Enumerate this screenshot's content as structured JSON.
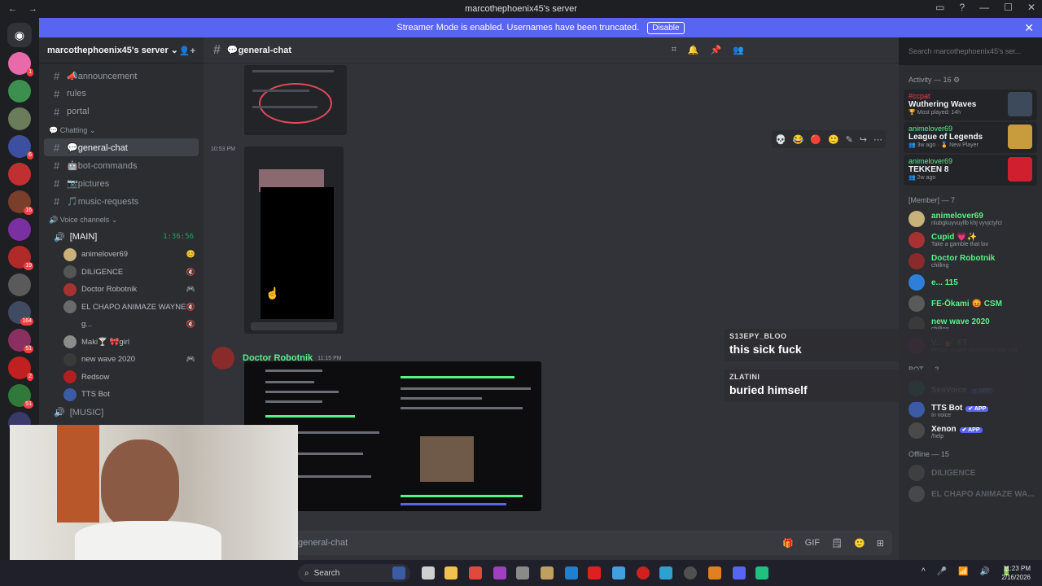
{
  "window": {
    "title": "marcothephoenix45's server",
    "nav_back": "←",
    "nav_forward": "→",
    "controls": [
      "▭",
      "?",
      "—",
      "☐",
      "✕"
    ]
  },
  "banner": {
    "text": "Streamer Mode is enabled. Usernames have been truncated.",
    "button": "Disable",
    "close": "✕"
  },
  "guild_badges": [
    "1",
    "6",
    "16",
    "19",
    "164",
    "51",
    "2",
    "51",
    "62"
  ],
  "sidebar": {
    "server_name": "marcothephoenix45's server ⌄",
    "channels_top": [
      {
        "label": "📣announcement"
      },
      {
        "label": "rules"
      },
      {
        "label": "portal"
      }
    ],
    "category_chatting": "💬 Chatting ⌄",
    "channels_chat": [
      {
        "label": "💬general-chat"
      },
      {
        "label": "🤖bot-commands"
      },
      {
        "label": "📷pictures"
      },
      {
        "label": "🎵music-requests"
      }
    ],
    "category_voice": "🔊 Voice channels ⌄",
    "voice_main": "[MAIN]",
    "voice_timer": "1:36:56",
    "voice_users": [
      {
        "name": "animelover69",
        "color": "#c9b27a",
        "icon": "😊"
      },
      {
        "name": "DILIGENCE",
        "color": "#555555",
        "icon": "🔇"
      },
      {
        "name": "Doctor Robotnik",
        "color": "#a83232",
        "icon": "🎮"
      },
      {
        "name": "EL CHAPO ANIMAZE WAYNE",
        "color": "#6a6a6a",
        "icon": "🔇"
      },
      {
        "name": "g...",
        "color": "#2b2d31",
        "icon": "🔇"
      },
      {
        "name": "Maki🍸 🎀girl",
        "color": "#8c8c8c",
        "icon": ""
      },
      {
        "name": "new wave 2020",
        "color": "#3a3a3a",
        "icon": "🎮"
      },
      {
        "name": "Redsow",
        "color": "#b02020",
        "icon": ""
      },
      {
        "name": "TTS Bot",
        "color": "#3b5ba5",
        "icon": ""
      }
    ],
    "voice_music": "[MUSIC]"
  },
  "chat": {
    "channel": "💬general-chat",
    "timestamp_1": "10:53 PM",
    "message_author": "Doctor Robotnik",
    "message_time": "11:15 PM",
    "composer_placeholder": "general-chat",
    "header_icons": [
      "⌗",
      "🔔",
      "📌",
      "👥"
    ],
    "toolbar_icons": [
      "💀",
      "😂",
      "🔴",
      "🙂",
      "✎",
      "↪",
      "⋯"
    ],
    "composer_tools": [
      "🎁",
      "GIF",
      "🗒",
      "🙂",
      "⊞"
    ]
  },
  "search": {
    "placeholder": "Search marcothephoenix45's ser..."
  },
  "members": {
    "activity_header": "Activity — 16 ⚙",
    "activities": [
      {
        "user": "#ccpat",
        "game": "Wuthering Waves",
        "detail": "🏆 Most played: 14h",
        "user_color": "#f23f43",
        "art": "#3c4a5c"
      },
      {
        "user": "animelover69",
        "game": "League of Legends",
        "detail": "👥 3w ago · 🏅 New Player",
        "user_color": "#57f287",
        "art": "#c89b3c"
      },
      {
        "user": "animelover69",
        "game": "TEKKEN 8",
        "detail": "👥 2w ago",
        "user_color": "#57f287",
        "art": "#d02030"
      }
    ],
    "member_header": "[Member] — 7",
    "member_list": [
      {
        "name": "animelover69",
        "status": "nlubgkuyvuyllb khj vyvjctyfcl",
        "color": "#57f287",
        "av": "#c9b27a"
      },
      {
        "name": "Cupid 💗✨",
        "status": "Take a gamble that lov",
        "color": "#57f287",
        "av": "#a83232"
      },
      {
        "name": "Doctor Robotnik",
        "status": "chilling",
        "color": "#57f287",
        "av": "#8a2b2b"
      },
      {
        "name": "e... 115",
        "status": "",
        "color": "#57f287",
        "av": "#2f7fd8"
      },
      {
        "name": "FE-Ōkami 😡 CSM",
        "status": "",
        "color": "#57f287",
        "av": "#5a5a5a"
      },
      {
        "name": "new wave 2020",
        "status": "chilling",
        "color": "#57f287",
        "av": "#3a3a3a"
      },
      {
        "name": "V... 💅 FT",
        "status": "Happy singles awareness day yall",
        "color": "#57f287",
        "av": "#a03060"
      }
    ],
    "bot_header": "BOT — 3",
    "bots": [
      {
        "name": "SeaVoice",
        "status": "",
        "app": "✔ APP",
        "av": "#1fa07a"
      },
      {
        "name": "TTS Bot",
        "status": "In voice",
        "app": "✔ APP",
        "av": "#3b5ba5"
      },
      {
        "name": "Xenon",
        "status": "/help",
        "app": "✔ APP",
        "av": "#4a4a4a"
      }
    ],
    "offline_header": "Offline — 15",
    "offline": [
      {
        "name": "DILIGENCE",
        "av": "#555555"
      },
      {
        "name": "EL CHAPO ANIMAZE WA...",
        "av": "#6a6a6a"
      }
    ]
  },
  "overlay_chat": [
    {
      "user": "S13EPY_BLOO",
      "text": "this sick fuck"
    },
    {
      "user": "ZLATINI",
      "text": "buried himself"
    }
  ],
  "taskbar": {
    "search": "Search",
    "time": "11:23 PM",
    "date": "2/16/2026",
    "tray": [
      "^",
      "🎤",
      "📶",
      "🔊",
      "🔋"
    ]
  }
}
